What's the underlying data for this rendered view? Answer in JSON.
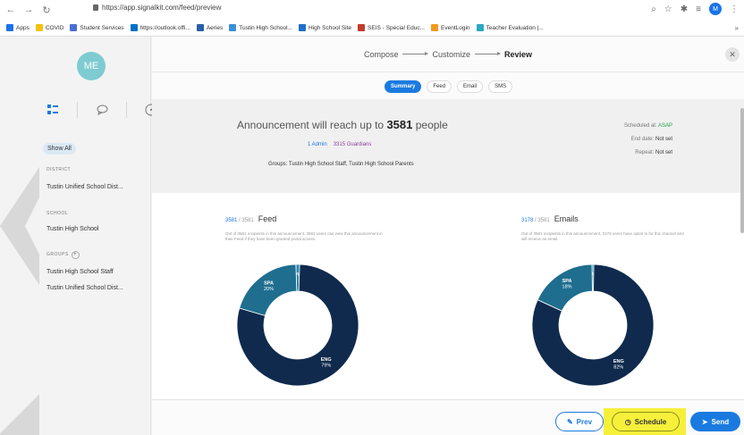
{
  "browser": {
    "url": "https://app.signalkit.com/feed/preview",
    "profile_initial": "M",
    "bookmarks": [
      {
        "label": "Apps",
        "color": "#1a73e8"
      },
      {
        "label": "COVID",
        "color": "#f4c20d"
      },
      {
        "label": "Student Services",
        "color": "#4a6fd1"
      },
      {
        "label": "https://outlook.offi...",
        "color": "#0072c6"
      },
      {
        "label": "Aeries",
        "color": "#2a5fa8"
      },
      {
        "label": "Tustin High School...",
        "color": "#3a8fd8"
      },
      {
        "label": "High School Site",
        "color": "#1e6fc8"
      },
      {
        "label": "SEIS - Special Educ...",
        "color": "#c23b2a"
      },
      {
        "label": "EventLogin",
        "color": "#f29a1d"
      },
      {
        "label": "Teacher Evaluation |...",
        "color": "#2aa8c4"
      }
    ]
  },
  "sidebar": {
    "avatar_initials": "ME",
    "show_all_label": "Show All",
    "district_label": "DISTRICT",
    "district_item": "Tustin Unified School Dist...",
    "school_label": "SCHOOL",
    "school_item": "Tustin High School",
    "groups_label": "GROUPS",
    "group_items": [
      "Tustin High School Staff",
      "Tustin Unified School Dist..."
    ]
  },
  "stepper": {
    "steps": [
      "Compose",
      "Customize",
      "Review"
    ],
    "active": "Review"
  },
  "tabs": [
    "Summary",
    "Feed",
    "Email",
    "SMS"
  ],
  "summary": {
    "reach_prefix": "Announcement will reach up to",
    "reach_count": "3581",
    "reach_suffix": "people",
    "admins": "1 Admin",
    "guardians": "3315 Guardians",
    "groups_label": "Groups:",
    "groups_value": "Tustin High School Staff, Tustin High School Parents",
    "scheduled_label": "Scheduled at:",
    "scheduled_value": "ASAP",
    "end_date_label": "End date:",
    "end_date_value": "Not set",
    "repeat_label": "Repeat:",
    "repeat_value": "Not set"
  },
  "feed": {
    "count": "3581",
    "total": "3581",
    "title": "Feed",
    "description": "Out of 3581 recipients in this announcement, 3581 users can view this announcement in their Feed if they have been granted portal access.",
    "slices": [
      {
        "label": "ENG",
        "value": 79,
        "color": "#0f2a4d",
        "display": "ENG\n79%"
      },
      {
        "label": "SPA",
        "value": 20,
        "color": "#1f6e8f",
        "display": "SPA\n20%"
      },
      {
        "label": "",
        "value": 1,
        "color": "#2a88b0",
        "display": "0%"
      }
    ]
  },
  "emails": {
    "count": "3178",
    "total": "3581",
    "title": "Emails",
    "description": "Out of 3581 recipients in this announcement, 3178 users have opted in for this channel and will receive an email.",
    "slices": [
      {
        "label": "ENG",
        "value": 82,
        "color": "#0f2a4d",
        "display": "ENG\n82%"
      },
      {
        "label": "SPA",
        "value": 18,
        "color": "#1f6e8f",
        "display": "SPA\n18%"
      },
      {
        "label": "",
        "value": 0.5,
        "color": "#2a88b0",
        "display": "0%"
      }
    ]
  },
  "footer": {
    "prev_label": "Prev",
    "schedule_label": "Schedule",
    "send_label": "Send"
  }
}
